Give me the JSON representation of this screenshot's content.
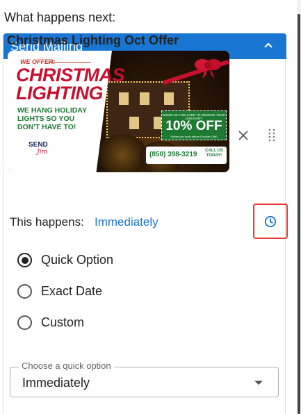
{
  "heading": "What happens next:",
  "panel": {
    "title": "Send Mailing",
    "accent_color": "#1976d2"
  },
  "card": {
    "title": "Christmas Lighting Oct Offer",
    "image": {
      "we_offer": "WE OFFER:",
      "line1": "CHRISTMAS",
      "line2": "LIGHTING",
      "tagline": "WE HANG HOLIDAY LIGHTS SO YOU DON'T HAVE TO!",
      "logo_top": "SEND",
      "logo_bottom": "Jim",
      "offer_small": "SHOW US THIS CARD TO RECEIVE YOUR DISCOUNT",
      "offer_big": "10% OFF",
      "offer_fine": "(When you book before October 15th)",
      "phone": "(850) 398-3219",
      "call_us": "CALL US TODAY!"
    },
    "remove_icon": "close-icon",
    "drag_icon": "drag-handle-icon"
  },
  "timing": {
    "label": "This happens:",
    "value": "Immediately",
    "icon": "clock-icon",
    "highlight_color": "#e53935"
  },
  "options": [
    {
      "label": "Quick Option",
      "checked": true
    },
    {
      "label": "Exact Date",
      "checked": false
    },
    {
      "label": "Custom",
      "checked": false
    }
  ],
  "quick_select": {
    "legend": "Choose a quick option",
    "value": "Immediately"
  }
}
